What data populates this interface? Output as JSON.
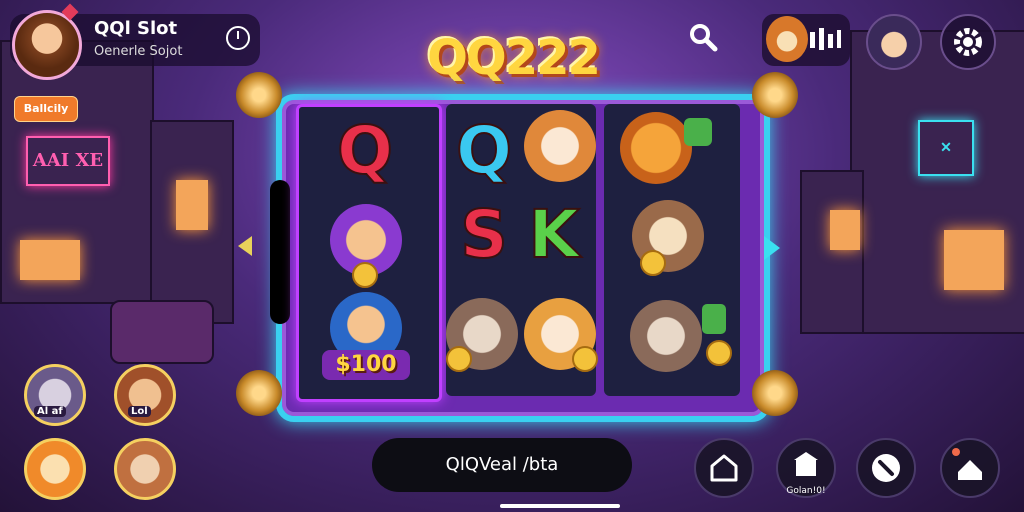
{
  "header": {
    "title": "QQl Slot",
    "subtitle": "Oenerle Sojot",
    "badge_label": "Ballcily"
  },
  "logo": {
    "text": "QQ222"
  },
  "reels": [
    {
      "symbols": [
        "Q",
        "miner-character",
        "S100-coin-kid"
      ]
    },
    {
      "symbols": [
        "Q",
        "dog-character",
        "S",
        "K",
        "cat-coins",
        "shiba-coins"
      ]
    },
    {
      "symbols": [
        "pumpkin-cat-money",
        "fox-coins",
        "cat-money-bag"
      ]
    }
  ],
  "reel_labels": {
    "value_tag": "$100"
  },
  "side_avatars": {
    "top_left_label": "Al af",
    "top_right_label": "Lol"
  },
  "bottom": {
    "pill_text": "QlQVeal /bta",
    "shop_label": "Golan!0!"
  },
  "colors": {
    "accent_cyan": "#3ad0f0",
    "frame_purple": "#6b2bb0",
    "logo_gold": "#ffd640",
    "badge_orange": "#f07a2a"
  }
}
